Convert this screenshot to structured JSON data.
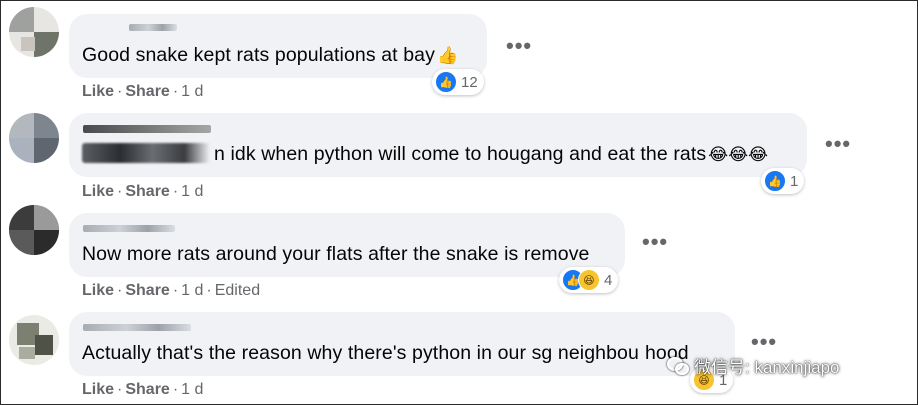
{
  "comments": [
    {
      "text": "Good snake kept rats populations at bay",
      "emoji_suffix": "👍",
      "reactions": [
        "like"
      ],
      "reaction_count": "12",
      "actions": {
        "like": "Like",
        "share": "Share",
        "time": "1 d",
        "edited": ""
      }
    },
    {
      "text": "n idk when python will come to hougang and eat the rats",
      "emoji_suffix": "😂😂😂",
      "reactions": [
        "like"
      ],
      "reaction_count": "1",
      "actions": {
        "like": "Like",
        "share": "Share",
        "time": "1 d",
        "edited": ""
      }
    },
    {
      "text": "Now more rats around your flats after the snake is remove",
      "emoji_suffix": "",
      "reactions": [
        "like",
        "haha"
      ],
      "reaction_count": "4",
      "actions": {
        "like": "Like",
        "share": "Share",
        "time": "1 d",
        "edited": "Edited"
      }
    },
    {
      "text": "Actually that's the reason why there's python in our sg neighbou",
      "text_tail": "hood",
      "emoji_suffix": "",
      "reactions": [
        "haha"
      ],
      "reaction_count": "1",
      "actions": {
        "like": "Like",
        "share": "Share",
        "time": "1 d",
        "edited": ""
      }
    }
  ],
  "more_label": "•••",
  "separator": "·",
  "watermark": "微信号: kanxinjiapo",
  "colors": {
    "like": "#1877f2",
    "haha": "#f7c42f",
    "bubble": "#f0f2f5",
    "meta": "#65676b"
  }
}
